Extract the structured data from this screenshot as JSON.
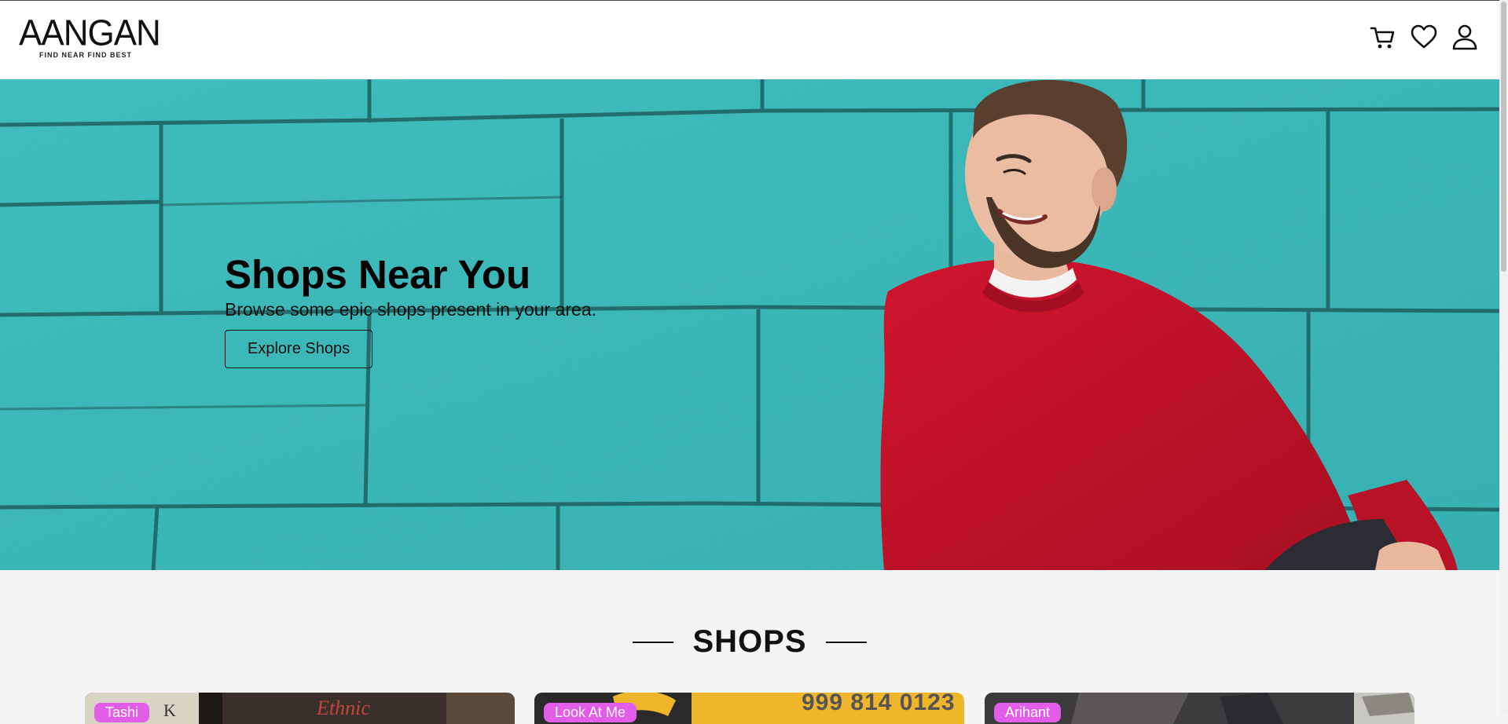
{
  "brand": {
    "name": "AANGAN",
    "tagline": "FIND NEAR FIND BEST"
  },
  "header": {
    "icons": [
      "cart-icon",
      "heart-icon",
      "user-icon"
    ]
  },
  "hero": {
    "title": "Shops Near You",
    "subtitle": "Browse some epic shops present in your area.",
    "cta_label": "Explore Shops"
  },
  "shops_section": {
    "title": "SHOPS",
    "cards": [
      {
        "name": "Tashi"
      },
      {
        "name": "Look At Me"
      },
      {
        "name": "Arihant"
      }
    ],
    "card2_sign_text": "999 814 0123"
  },
  "colors": {
    "tag_background": "#e35ee8",
    "hero_wall": "#3fc1c1",
    "sweater": "#c4122a"
  }
}
